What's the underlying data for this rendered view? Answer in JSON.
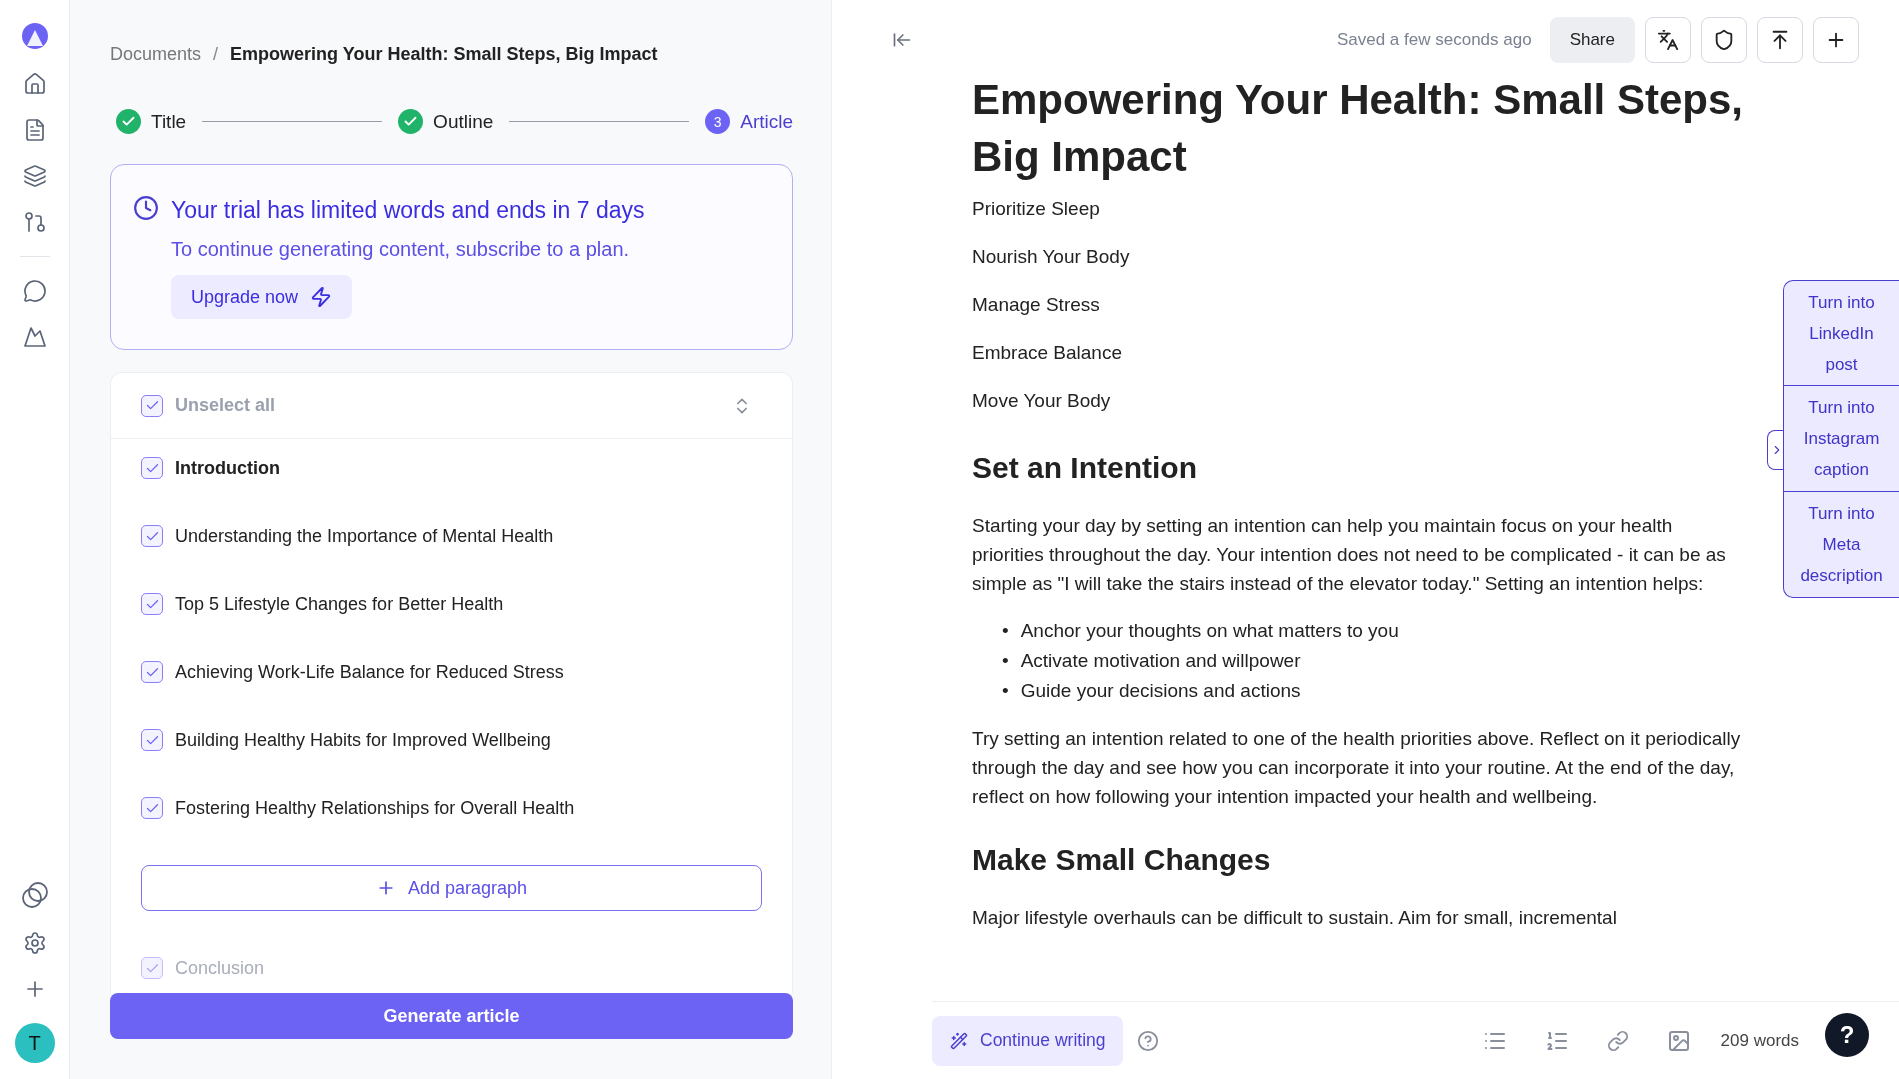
{
  "sidebar": {
    "avatar": "T"
  },
  "breadcrumb": {
    "root": "Documents",
    "separator": "/",
    "current": "Empowering Your Health: Small Steps, Big Impact"
  },
  "steps": [
    {
      "label": "Title",
      "completed": true,
      "selected": false
    },
    {
      "label": "Outline",
      "completed": true,
      "selected": false
    },
    {
      "label": "Article",
      "completed": false,
      "selected": true,
      "number": "3"
    }
  ],
  "trial": {
    "title": "Your trial has limited words and ends in 7 days",
    "text": "To continue generating content, subscribe to a plan.",
    "button": "Upgrade now"
  },
  "outline": {
    "select_all": {
      "label": "Unselect all",
      "checked": true
    },
    "items": [
      {
        "label": "Introduction",
        "kind": "section",
        "checked": true
      },
      {
        "label": "Understanding the Importance of Mental Health",
        "kind": "paragraph",
        "checked": true
      },
      {
        "label": "Top 5 Lifestyle Changes for Better Health",
        "kind": "paragraph",
        "checked": true
      },
      {
        "label": "Achieving Work-Life Balance for Reduced Stress",
        "kind": "paragraph",
        "checked": true
      },
      {
        "label": "Building Healthy Habits for Improved Wellbeing",
        "kind": "paragraph",
        "checked": true
      },
      {
        "label": "Fostering Healthy Relationships for Overall Health",
        "kind": "paragraph",
        "checked": true
      },
      {
        "label": "Add paragraph",
        "kind": "add"
      },
      {
        "label": "Conclusion",
        "kind": "faded",
        "checked": true
      }
    ],
    "button": "Generate article"
  },
  "editor": {
    "status": "Saved a few seconds ago",
    "share": "Share",
    "title": "Empowering Your Health: Small Steps, Big Impact",
    "blocks": [
      {
        "kind": "line",
        "text": "Prioritize Sleep"
      },
      {
        "kind": "line",
        "text": "Nourish Your Body"
      },
      {
        "kind": "line",
        "text": "Manage Stress"
      },
      {
        "kind": "line",
        "text": "Embrace Balance"
      },
      {
        "kind": "line",
        "text": "Move Your Body"
      },
      {
        "kind": "heading",
        "text": "Set an Intention"
      },
      {
        "kind": "paragraph",
        "text": "Starting your day by setting an intention can help you maintain focus on your health priorities throughout the day. Your intention does not need to be complicated - it can be as simple as \"I will take the stairs instead of the elevator today.\" Setting an intention helps:"
      },
      {
        "kind": "bullets",
        "items": [
          {
            "marker": "•",
            "text": "Anchor your thoughts on what matters to you"
          },
          {
            "marker": "•",
            "text": "Activate motivation and willpower"
          },
          {
            "marker": "•",
            "text": "Guide your decisions and actions"
          }
        ]
      },
      {
        "kind": "paragraph",
        "text": "Try setting an intention related to one of the health priorities above. Reflect on it periodically through the day and see how you can incorporate it into your routine. At the end of the day, reflect on how following your intention impacted your health and wellbeing."
      },
      {
        "kind": "heading",
        "text": "Make Small Changes"
      },
      {
        "kind": "paragraph",
        "text": "Major lifestyle overhauls can be difficult to sustain. Aim for small, incremental"
      }
    ],
    "continue": "Continue writing",
    "word_count": "209 words"
  },
  "actions": [
    "Turn into LinkedIn post",
    "Turn into Instagram caption",
    "Turn into Meta description"
  ],
  "help": "?"
}
